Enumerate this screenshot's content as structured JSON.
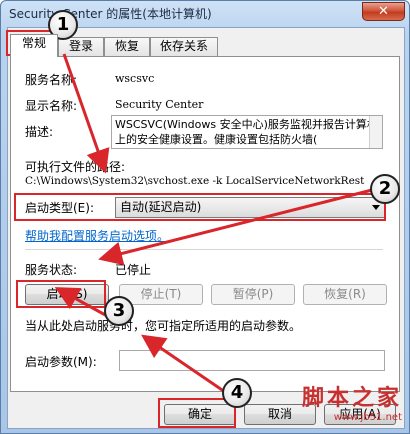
{
  "window": {
    "title": "Security Center 的属性(本地计算机)",
    "close_label": "✕"
  },
  "tabs": [
    {
      "label": "常规"
    },
    {
      "label": "登录"
    },
    {
      "label": "恢复"
    },
    {
      "label": "依存关系"
    }
  ],
  "general": {
    "service_name_label": "服务名称:",
    "service_name_value": "wscsvc",
    "display_name_label": "显示名称:",
    "display_name_value": "Security Center",
    "description_label": "描述:",
    "description_value": "WSCSVC(Windows 安全中心)服务监视并报告计算机上的安全健康设置。健康设置包括防火墙(",
    "exec_path_label": "可执行文件的路径:",
    "exec_path_value": "C:\\Windows\\System32\\svchost.exe -k LocalServiceNetworkRest",
    "startup_type_label": "启动类型(E):",
    "startup_type_value": "自动(延迟启动)",
    "help_link": "帮助我配置服务启动选项。",
    "service_status_label": "服务状态:",
    "service_status_value": "已停止",
    "start_button": "启动(S)",
    "stop_button": "停止(T)",
    "pause_button": "暂停(P)",
    "resume_button": "恢复(R)",
    "hint_text": "当从此处启动服务时，您可指定所适用的启动参数。",
    "start_params_label": "启动参数(M):",
    "start_params_value": ""
  },
  "footer": {
    "ok_button": "确定",
    "cancel_button": "取消",
    "apply_button": "应用(A)"
  },
  "annotations": {
    "m1": "1",
    "m2": "2",
    "m3": "3",
    "m4": "4"
  },
  "watermark": {
    "logo": "脚本之家",
    "url": "www.jb51.net"
  },
  "colors": {
    "annotation_red": "#d8262b",
    "link_blue": "#0066cc"
  }
}
